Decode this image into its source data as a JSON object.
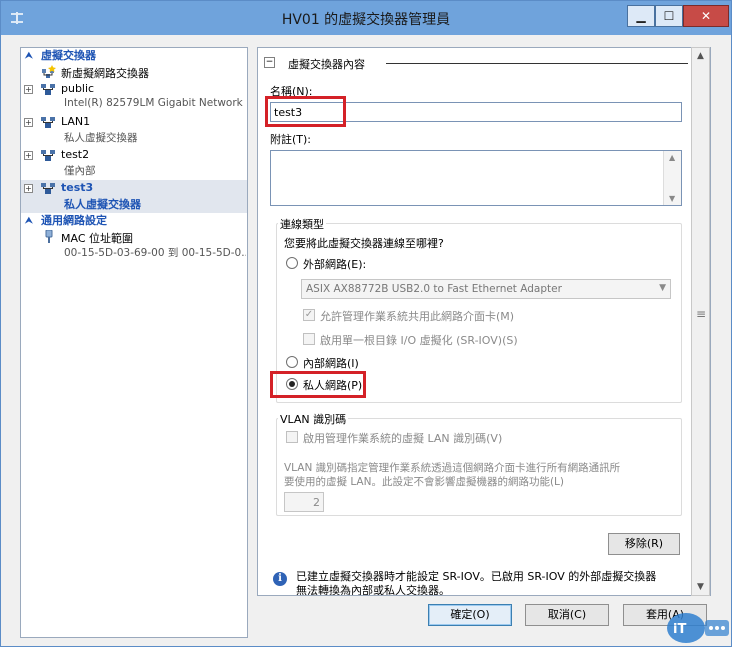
{
  "window": {
    "title": "HV01 的虛擬交換器管理員"
  },
  "left_pane": {
    "switches_header": "虛擬交換器",
    "new_switch": "新虛擬網路交換器",
    "switches": [
      {
        "name": "public",
        "detail": "Intel(R) 82579LM Gigabit Network ..."
      },
      {
        "name": "LAN1",
        "detail": "私人虛擬交換器"
      },
      {
        "name": "test2",
        "detail": "僅內部"
      },
      {
        "name": "test3",
        "detail": "私人虛擬交換器",
        "selected": true
      }
    ],
    "global_header": "通用網路設定",
    "mac_title": "MAC 位址範圍",
    "mac_detail": "00-15-5D-03-69-00 到 00-15-5D-0..."
  },
  "properties": {
    "header": "虛擬交換器內容",
    "name_label": "名稱(N):",
    "name_value": "test3",
    "notes_label": "附註(T):",
    "notes_value": "",
    "connection_group": "連線類型",
    "connection_question": "您要將此虛擬交換器連線至哪裡?",
    "external_label": "外部網路(E):",
    "adapter_value": "ASIX AX88772B USB2.0 to Fast Ethernet Adapter",
    "allow_mgmt_label": "允許管理作業系統共用此網路介面卡(M)",
    "sriov_label": "啟用單一根目錄 I/O 虛擬化 (SR-IOV)(S)",
    "internal_label": "內部網路(I)",
    "private_label": "私人網路(P)",
    "selected_connection": "private",
    "vlan_group": "VLAN 識別碼",
    "vlan_checkbox_label": "啟用管理作業系統的虛擬 LAN 識別碼(V)",
    "vlan_desc_line1": "VLAN 識別碼指定管理作業系統透過這個網路介面卡進行所有網路通訊所",
    "vlan_desc_line2": "要使用的虛擬 LAN。此設定不會影響虛擬機器的網路功能(L)",
    "vlan_value": "2",
    "remove_button": "移除(R)"
  },
  "info": {
    "line1": "已建立虛擬交換器時才能設定 SR-IOV。已啟用 SR-IOV 的外部虛擬交換器",
    "line2": "無法轉換為內部或私人交換器。"
  },
  "footer": {
    "ok": "確定(O)",
    "cancel": "取消(C)",
    "apply": "套用(A)"
  },
  "icons": {
    "switch": "network-switch-icon",
    "new_switch": "new-switch-icon",
    "mac": "network-plug-icon",
    "info": "info-icon"
  },
  "colors": {
    "title_bar": "#6fa3dc",
    "close_button": "#c74b47",
    "section_header": "#1e54b4",
    "highlight": "#d42127"
  }
}
